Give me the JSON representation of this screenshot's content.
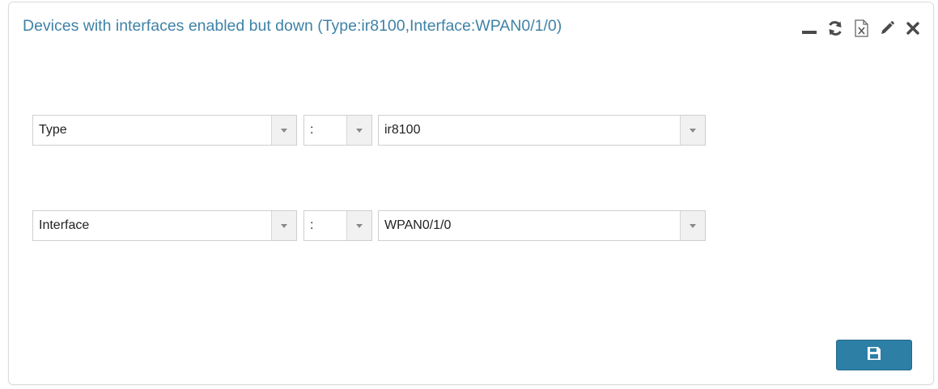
{
  "panel": {
    "title": "Devices with interfaces enabled but down (Type:ir8100,Interface:WPAN0/1/0)",
    "toolbar": [
      "minimize-icon",
      "refresh-icon",
      "excel-export-icon",
      "edit-icon",
      "close-icon"
    ]
  },
  "filters": [
    {
      "field": "Type",
      "operator": ":",
      "value": "ir8100"
    },
    {
      "field": "Interface",
      "operator": ":",
      "value": "WPAN0/1/0"
    }
  ],
  "save_icon": "floppy-disk-icon",
  "colors": {
    "title": "#3f82a6",
    "button": "#2d7fa6"
  }
}
